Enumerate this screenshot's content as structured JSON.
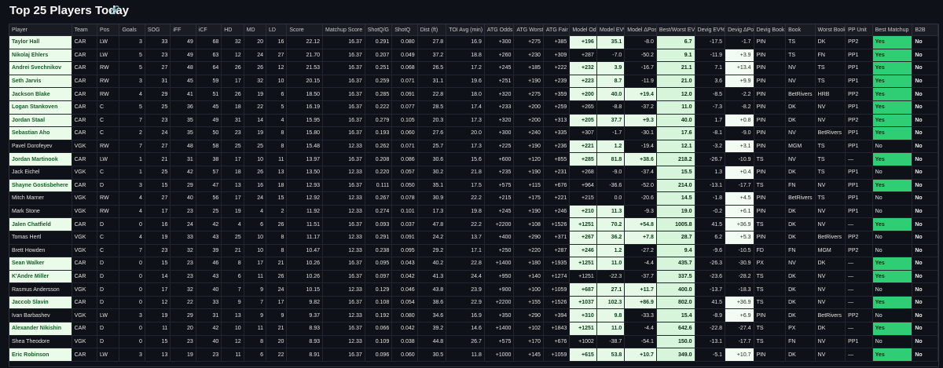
{
  "page": {
    "title": "Top 25 Players Today",
    "title_icon": "link-icon"
  },
  "table": {
    "columns": [
      "Player",
      "Team",
      "Pos",
      "Goals",
      "SOG",
      "iFF",
      "iCF",
      "HD",
      "MD",
      "LD",
      "Score",
      "Matchup Score",
      "ShotQ/G",
      "ShotQ",
      "Dist (ft)",
      "TOI Avg (min)",
      "ATG Odds",
      "ATG Worst",
      "ATG Fair",
      "Model Odds",
      "Model EV%",
      "Model ΔPos",
      "Best/Worst EV%",
      "Devig EV%",
      "Devig ΔPos",
      "Devig Book",
      "Book",
      "Worst Book",
      "PP Unit",
      "Best Matchup",
      "B2B"
    ],
    "rows": [
      [
        "Taylor Hall",
        "CAR",
        "LW",
        "3",
        "33",
        "49",
        "68",
        "32",
        "20",
        "16",
        "22.12",
        "16.37",
        "0.291",
        "0.080",
        "27.8",
        "16.9",
        "+300",
        "+275",
        "+385",
        "+196",
        "35.1",
        "-8.0",
        "6.7",
        "-17.5",
        "-1.7",
        "PIN",
        "TS",
        "DK",
        "PP2",
        "Yes",
        "No"
      ],
      [
        "Nikolaj Ehlers",
        "CAR",
        "LW",
        "5",
        "23",
        "49",
        "63",
        "12",
        "24",
        "27",
        "21.70",
        "16.37",
        "0.207",
        "0.049",
        "37.2",
        "18.8",
        "+260",
        "+230",
        "+309",
        "+287",
        "-7.0",
        "-50.2",
        "9.1",
        "-11.9",
        "+3.9",
        "PIN",
        "TS",
        "FN",
        "PP1",
        "Yes",
        "No"
      ],
      [
        "Andrei Svechnikov",
        "CAR",
        "RW",
        "5",
        "27",
        "48",
        "64",
        "26",
        "26",
        "12",
        "21.53",
        "16.37",
        "0.251",
        "0.068",
        "26.5",
        "17.2",
        "+245",
        "+185",
        "+222",
        "+232",
        "3.9",
        "-16.7",
        "21.1",
        "7.1",
        "+13.4",
        "PIN",
        "NV",
        "TS",
        "PP1",
        "Yes",
        "No"
      ],
      [
        "Seth Jarvis",
        "CAR",
        "RW",
        "3",
        "31",
        "45",
        "59",
        "17",
        "32",
        "10",
        "20.15",
        "16.37",
        "0.259",
        "0.071",
        "31.1",
        "19.6",
        "+251",
        "+190",
        "+239",
        "+223",
        "8.7",
        "-11.9",
        "21.0",
        "3.6",
        "+9.9",
        "PIN",
        "NV",
        "TS",
        "PP1",
        "Yes",
        "No"
      ],
      [
        "Jackson Blake",
        "CAR",
        "RW",
        "4",
        "29",
        "41",
        "51",
        "26",
        "19",
        "6",
        "18.50",
        "16.37",
        "0.285",
        "0.091",
        "22.8",
        "18.0",
        "+320",
        "+275",
        "+359",
        "+200",
        "40.0",
        "+19.4",
        "12.0",
        "-8.5",
        "-2.2",
        "PIN",
        "BetRivers",
        "HRB",
        "PP2",
        "Yes",
        "No"
      ],
      [
        "Logan Stankoven",
        "CAR",
        "C",
        "5",
        "25",
        "36",
        "45",
        "18",
        "22",
        "5",
        "16.19",
        "16.37",
        "0.222",
        "0.077",
        "28.5",
        "17.4",
        "+233",
        "+200",
        "+259",
        "+265",
        "-8.8",
        "-37.2",
        "11.0",
        "-7.3",
        "-8.2",
        "PIN",
        "DK",
        "NV",
        "PP1",
        "Yes",
        "No"
      ],
      [
        "Jordan Staal",
        "CAR",
        "C",
        "7",
        "23",
        "35",
        "49",
        "31",
        "14",
        "4",
        "15.95",
        "16.37",
        "0.279",
        "0.105",
        "20.3",
        "17.3",
        "+320",
        "+200",
        "+313",
        "+205",
        "37.7",
        "+9.3",
        "40.0",
        "1.7",
        "+0.8",
        "PIN",
        "DK",
        "NV",
        "PP2",
        "Yes",
        "No"
      ],
      [
        "Sebastian Aho",
        "CAR",
        "C",
        "2",
        "24",
        "35",
        "50",
        "23",
        "19",
        "8",
        "15.80",
        "16.37",
        "0.193",
        "0.060",
        "27.6",
        "20.0",
        "+300",
        "+240",
        "+335",
        "+307",
        "-1.7",
        "-30.1",
        "17.6",
        "-8.1",
        "-9.0",
        "PIN",
        "NV",
        "BetRivers",
        "PP1",
        "Yes",
        "No"
      ],
      [
        "Pavel Dorofeyev",
        "VGK",
        "RW",
        "7",
        "27",
        "48",
        "58",
        "25",
        "25",
        "8",
        "15.48",
        "12.33",
        "0.262",
        "0.071",
        "25.7",
        "17.3",
        "+225",
        "+190",
        "+236",
        "+221",
        "1.2",
        "-19.4",
        "12.1",
        "-3.2",
        "+3.1",
        "PIN",
        "MGM",
        "TS",
        "PP1",
        "No",
        "No"
      ],
      [
        "Jordan Martinook",
        "CAR",
        "LW",
        "1",
        "21",
        "31",
        "38",
        "17",
        "10",
        "11",
        "13.97",
        "16.37",
        "0.208",
        "0.086",
        "30.6",
        "15.6",
        "+600",
        "+120",
        "+855",
        "+285",
        "81.8",
        "+38.6",
        "218.2",
        "-26.7",
        "-10.9",
        "TS",
        "NV",
        "TS",
        "—",
        "Yes",
        "No"
      ],
      [
        "Jack Eichel",
        "VGK",
        "C",
        "1",
        "25",
        "42",
        "57",
        "18",
        "26",
        "13",
        "13.50",
        "12.33",
        "0.220",
        "0.057",
        "30.2",
        "21.8",
        "+235",
        "+190",
        "+231",
        "+268",
        "-9.0",
        "-37.4",
        "15.5",
        "1.3",
        "+0.4",
        "PIN",
        "DK",
        "TS",
        "PP1",
        "No",
        "No"
      ],
      [
        "Shayne Gostisbehere",
        "CAR",
        "D",
        "3",
        "15",
        "29",
        "47",
        "13",
        "16",
        "18",
        "12.93",
        "16.37",
        "0.111",
        "0.050",
        "35.1",
        "17.5",
        "+575",
        "+115",
        "+676",
        "+964",
        "-36.6",
        "-52.0",
        "214.0",
        "-13.1",
        "-17.7",
        "TS",
        "FN",
        "NV",
        "PP1",
        "Yes",
        "No"
      ],
      [
        "Mitch Marner",
        "VGK",
        "RW",
        "4",
        "27",
        "40",
        "56",
        "17",
        "24",
        "15",
        "12.92",
        "12.33",
        "0.267",
        "0.078",
        "30.9",
        "22.2",
        "+215",
        "+175",
        "+221",
        "+215",
        "0.0",
        "-20.6",
        "14.5",
        "-1.8",
        "+4.5",
        "PIN",
        "BetRivers",
        "TS",
        "PP1",
        "No",
        "No"
      ],
      [
        "Mark Stone",
        "VGK",
        "RW",
        "4",
        "17",
        "23",
        "25",
        "19",
        "4",
        "2",
        "11.92",
        "12.33",
        "0.274",
        "0.101",
        "17.3",
        "19.8",
        "+245",
        "+190",
        "+246",
        "+210",
        "11.3",
        "-9.3",
        "19.0",
        "-0.2",
        "+6.1",
        "PIN",
        "DK",
        "NV",
        "PP1",
        "No",
        "No"
      ],
      [
        "Jalen Chatfield",
        "CAR",
        "D",
        "0",
        "16",
        "24",
        "42",
        "4",
        "6",
        "26",
        "11.51",
        "16.37",
        "0.093",
        "0.037",
        "47.8",
        "22.2",
        "+2200",
        "+108",
        "+1526",
        "+1251",
        "70.2",
        "+54.8",
        "1005.8",
        "41.5",
        "+36.9",
        "TS",
        "DK",
        "NV",
        "—",
        "Yes",
        "No"
      ],
      [
        "Tomas Hertl",
        "VGK",
        "C",
        "4",
        "19",
        "33",
        "43",
        "25",
        "10",
        "8",
        "11.17",
        "12.33",
        "0.291",
        "0.091",
        "24.2",
        "13.7",
        "+400",
        "+290",
        "+371",
        "+267",
        "36.2",
        "+7.8",
        "28.7",
        "6.2",
        "+5.3",
        "PIN",
        "DK",
        "BetRivers",
        "PP2",
        "No",
        "No"
      ],
      [
        "Brett Howden",
        "VGK",
        "C",
        "7",
        "23",
        "32",
        "39",
        "21",
        "10",
        "8",
        "10.47",
        "12.33",
        "0.238",
        "0.095",
        "29.2",
        "17.1",
        "+250",
        "+220",
        "+287",
        "+246",
        "1.2",
        "-27.2",
        "9.4",
        "-9.6",
        "-10.5",
        "FD",
        "FN",
        "MGM",
        "PP2",
        "No",
        "No"
      ],
      [
        "Sean Walker",
        "CAR",
        "D",
        "0",
        "15",
        "23",
        "46",
        "8",
        "17",
        "21",
        "10.26",
        "16.37",
        "0.095",
        "0.043",
        "40.2",
        "22.8",
        "+1400",
        "+180",
        "+1935",
        "+1251",
        "11.0",
        "-4.4",
        "435.7",
        "-26.3",
        "-30.9",
        "PX",
        "NV",
        "DK",
        "—",
        "Yes",
        "No"
      ],
      [
        "K'Andre Miller",
        "CAR",
        "D",
        "0",
        "14",
        "23",
        "43",
        "6",
        "11",
        "26",
        "10.26",
        "16.37",
        "0.097",
        "0.042",
        "41.3",
        "24.4",
        "+950",
        "+140",
        "+1274",
        "+1251",
        "-22.3",
        "-37.7",
        "337.5",
        "-23.6",
        "-28.2",
        "TS",
        "DK",
        "NV",
        "—",
        "Yes",
        "No"
      ],
      [
        "Rasmus Andersson",
        "VGK",
        "D",
        "0",
        "17",
        "32",
        "40",
        "7",
        "9",
        "24",
        "10.15",
        "12.33",
        "0.129",
        "0.046",
        "43.8",
        "23.9",
        "+900",
        "+100",
        "+1059",
        "+687",
        "27.1",
        "+11.7",
        "400.0",
        "-13.7",
        "-18.3",
        "TS",
        "DK",
        "NV",
        "—",
        "No",
        "No"
      ],
      [
        "Jaccob Slavin",
        "CAR",
        "D",
        "0",
        "12",
        "22",
        "33",
        "9",
        "7",
        "17",
        "9.82",
        "16.37",
        "0.108",
        "0.054",
        "38.6",
        "22.9",
        "+2200",
        "+155",
        "+1526",
        "+1037",
        "102.3",
        "+86.9",
        "802.0",
        "41.5",
        "+36.9",
        "TS",
        "DK",
        "NV",
        "—",
        "Yes",
        "No"
      ],
      [
        "Ivan Barbashev",
        "VGK",
        "LW",
        "3",
        "19",
        "29",
        "31",
        "13",
        "9",
        "9",
        "9.37",
        "12.33",
        "0.192",
        "0.080",
        "34.6",
        "16.9",
        "+350",
        "+290",
        "+394",
        "+310",
        "9.8",
        "-33.3",
        "15.4",
        "-8.9",
        "+6.9",
        "PIN",
        "DK",
        "BetRivers",
        "PP2",
        "No",
        "No"
      ],
      [
        "Alexander Nikishin",
        "CAR",
        "D",
        "0",
        "11",
        "20",
        "42",
        "10",
        "11",
        "21",
        "8.93",
        "16.37",
        "0.066",
        "0.042",
        "39.2",
        "14.6",
        "+1400",
        "+102",
        "+1843",
        "+1251",
        "11.0",
        "-4.4",
        "642.6",
        "-22.8",
        "-27.4",
        "TS",
        "PX",
        "DK",
        "—",
        "Yes",
        "No"
      ],
      [
        "Shea Theodore",
        "VGK",
        "D",
        "0",
        "15",
        "23",
        "40",
        "12",
        "8",
        "20",
        "8.93",
        "12.33",
        "0.109",
        "0.038",
        "44.8",
        "26.7",
        "+575",
        "+170",
        "+676",
        "+1002",
        "-38.7",
        "-54.1",
        "150.0",
        "-13.1",
        "-17.7",
        "TS",
        "FN",
        "NV",
        "PP1",
        "No",
        "No"
      ],
      [
        "Eric Robinson",
        "CAR",
        "LW",
        "3",
        "13",
        "19",
        "23",
        "11",
        "6",
        "22",
        "8.91",
        "16.37",
        "0.096",
        "0.060",
        "30.5",
        "11.8",
        "+1000",
        "+145",
        "+1059",
        "+615",
        "53.8",
        "+10.7",
        "349.0",
        "-5.1",
        "+10.7",
        "PIN",
        "DK",
        "NV",
        "—",
        "Yes",
        "No"
      ]
    ]
  }
}
